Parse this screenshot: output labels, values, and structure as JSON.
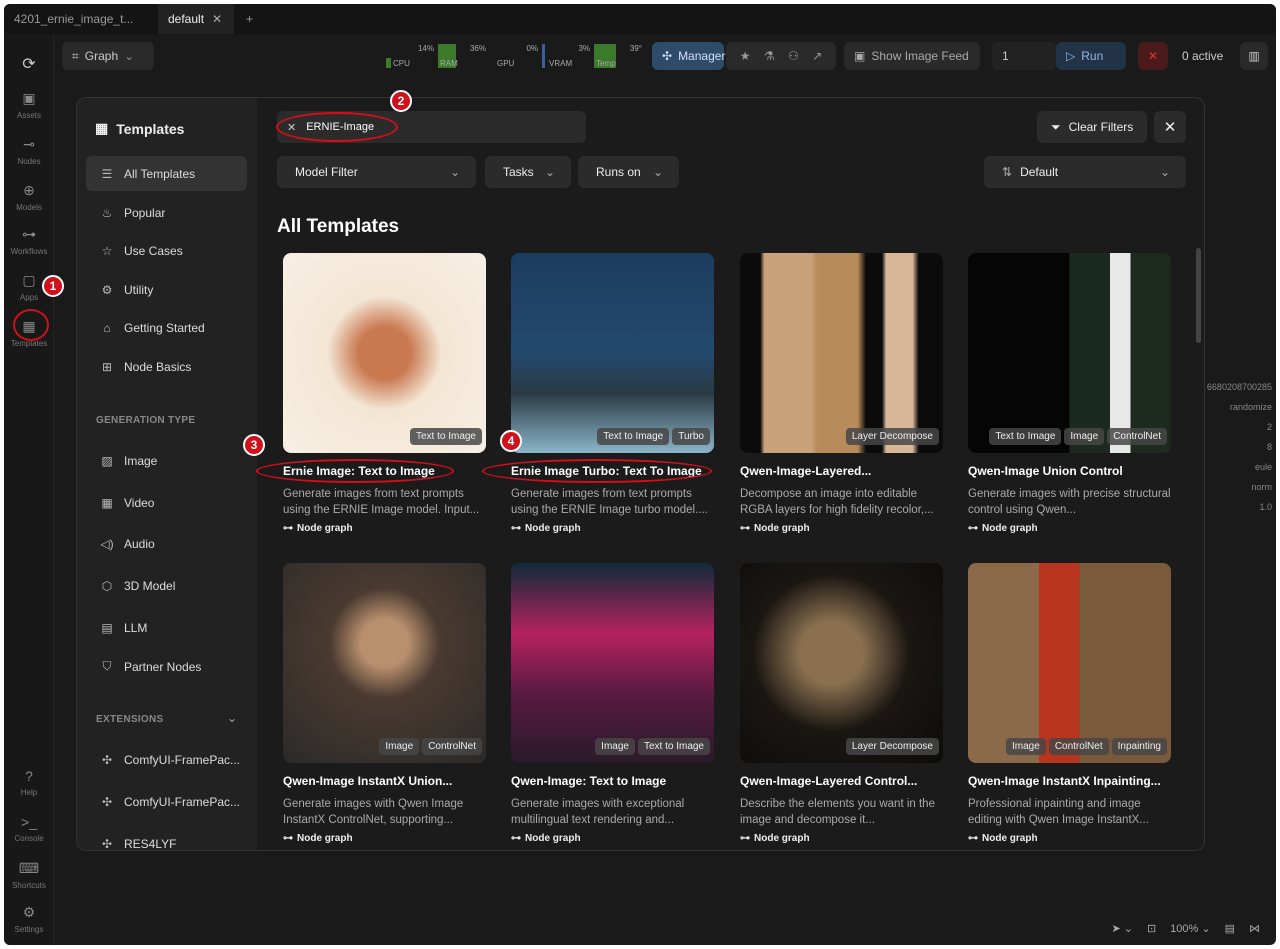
{
  "tabs": [
    {
      "label": "4201_ernie_image_t..."
    },
    {
      "label": "default"
    }
  ],
  "toolbar": {
    "graph_label": "Graph",
    "meters": [
      {
        "label": "CPU",
        "value": "14%"
      },
      {
        "label": "RAM",
        "value": "36%"
      },
      {
        "label": "GPU",
        "value": "0%"
      },
      {
        "label": "VRAM",
        "value": "3%"
      },
      {
        "label": "Temp",
        "value": "39°"
      }
    ],
    "manager_label": "Manager",
    "show_feed_label": "Show Image Feed",
    "queue_count": "1",
    "run_label": "Run",
    "active_label": "0 active"
  },
  "rail": [
    {
      "label": "Assets"
    },
    {
      "label": "Nodes"
    },
    {
      "label": "Models"
    },
    {
      "label": "Workflows"
    },
    {
      "label": "Apps"
    },
    {
      "label": "Templates"
    },
    {
      "label": "Help"
    },
    {
      "label": "Console"
    },
    {
      "label": "Shortcuts"
    },
    {
      "label": "Settings"
    }
  ],
  "canvas_right": {
    "values": [
      "6680208700285",
      "randomize",
      "2",
      "8",
      "eule",
      "norm",
      "1.0"
    ]
  },
  "bottom": {
    "zoom": "100%"
  },
  "modal": {
    "title": "Templates",
    "nav": [
      {
        "label": "All Templates"
      },
      {
        "label": "Popular"
      },
      {
        "label": "Use Cases"
      },
      {
        "label": "Utility"
      },
      {
        "label": "Getting Started"
      },
      {
        "label": "Node Basics"
      }
    ],
    "section_generation": "GENERATION TYPE",
    "gen": [
      {
        "label": "Image"
      },
      {
        "label": "Video"
      },
      {
        "label": "Audio"
      },
      {
        "label": "3D Model"
      },
      {
        "label": "LLM"
      },
      {
        "label": "Partner Nodes"
      }
    ],
    "section_extensions": "EXTENSIONS",
    "ext": [
      {
        "label": "ComfyUI-FramePac..."
      },
      {
        "label": "ComfyUI-FramePac..."
      },
      {
        "label": "RES4LYF"
      }
    ],
    "search": {
      "value": "ERNIE-Image"
    },
    "clear_filters": "Clear Filters",
    "filters": {
      "model": "Model Filter",
      "tasks": "Tasks",
      "runs_on": "Runs on",
      "sort": "Default"
    },
    "heading": "All Templates",
    "foot_label": "Node graph",
    "cards": [
      {
        "title": "Ernie Image: Text to Image",
        "desc": "Generate images from text prompts using the ERNIE Image model. Input...",
        "tags": [
          "Text to Image"
        ]
      },
      {
        "title": "Ernie Image Turbo: Text To Image",
        "desc": "Generate images from text prompts using the ERNIE Image turbo model....",
        "tags": [
          "Text to Image",
          "Turbo"
        ]
      },
      {
        "title": "Qwen-Image-Layered...",
        "desc": "Decompose an image into editable RGBA layers for high fidelity recolor,...",
        "tags": [
          "Layer Decompose"
        ]
      },
      {
        "title": "Qwen-Image Union Control",
        "desc": "Generate images with precise structural control using Qwen...",
        "tags": [
          "Text to Image",
          "Image",
          "ControlNet"
        ]
      },
      {
        "title": "Qwen-Image InstantX Union...",
        "desc": "Generate images with Qwen Image InstantX ControlNet, supporting...",
        "tags": [
          "Image",
          "ControlNet"
        ]
      },
      {
        "title": "Qwen-Image: Text to Image",
        "desc": "Generate images with exceptional multilingual text rendering and...",
        "tags": [
          "Image",
          "Text to Image"
        ]
      },
      {
        "title": "Qwen-Image-Layered Control...",
        "desc": "Describe the elements you want in the image and decompose it...",
        "tags": [
          "Layer Decompose"
        ]
      },
      {
        "title": "Qwen-Image InstantX Inpainting...",
        "desc": "Professional inpainting and image editing with Qwen Image InstantX...",
        "tags": [
          "Image",
          "ControlNet",
          "Inpainting"
        ]
      }
    ],
    "annotations": [
      "1",
      "2",
      "3",
      "4"
    ]
  }
}
